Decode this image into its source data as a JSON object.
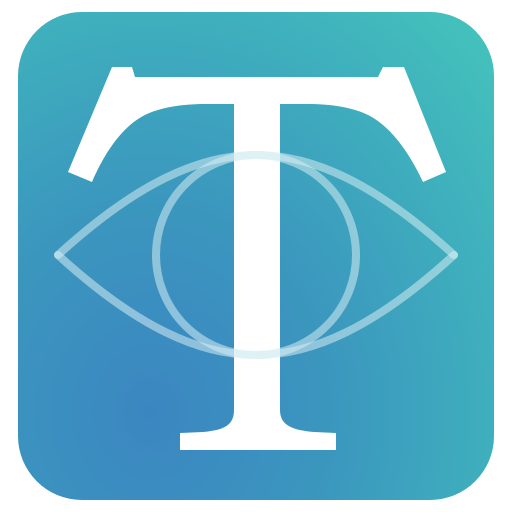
{
  "app_icon": {
    "name": "eye-letter-t-app-icon",
    "letter": "T",
    "colors": {
      "gradient_light": "#45c5bb",
      "gradient_mid": "#3fb0bd",
      "gradient_dark": "#3b86c1",
      "letter_fill": "#ffffff",
      "eye_stroke": "#d6edf3"
    },
    "icons": [
      "eye-icon",
      "letter-t-glyph"
    ]
  }
}
